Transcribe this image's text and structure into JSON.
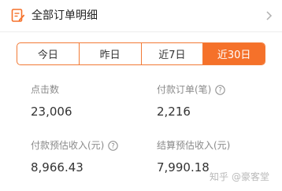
{
  "header": {
    "title": "全部订单明细",
    "icons": {
      "title": "note-edit-icon",
      "chevron": "chevron-right-icon"
    }
  },
  "tabs": [
    {
      "label": "今日",
      "active": false
    },
    {
      "label": "昨日",
      "active": false
    },
    {
      "label": "近7日",
      "active": false
    },
    {
      "label": "近30日",
      "active": true
    }
  ],
  "metrics": [
    {
      "label": "点击数",
      "value": "23,006",
      "has_help": false
    },
    {
      "label": "付款订单(笔)",
      "value": "2,216",
      "has_help": true
    },
    {
      "label": "付款预估收入(元)",
      "value": "8,966.43",
      "has_help": true
    },
    {
      "label": "结算预估收入(元)",
      "value": "7,990.18",
      "has_help": false
    }
  ],
  "watermark": {
    "site": "知乎",
    "author": "@豪客堂"
  },
  "colors": {
    "accent": "#f5712a",
    "label": "#8a8a8a",
    "text": "#333333"
  }
}
